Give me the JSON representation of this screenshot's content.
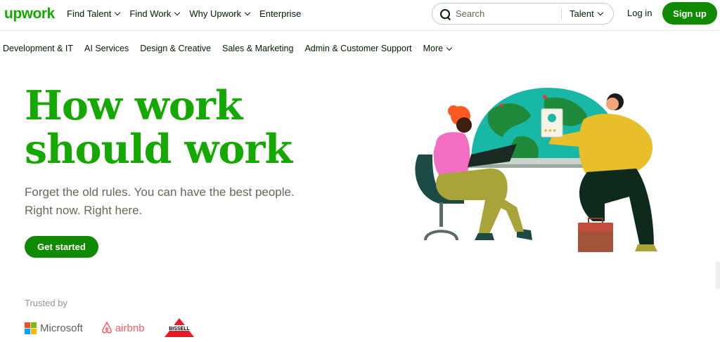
{
  "header": {
    "logo": "upwork",
    "nav": [
      {
        "label": "Find Talent",
        "has_dropdown": true
      },
      {
        "label": "Find Work",
        "has_dropdown": true
      },
      {
        "label": "Why Upwork",
        "has_dropdown": true
      },
      {
        "label": "Enterprise",
        "has_dropdown": false
      }
    ],
    "search": {
      "placeholder": "Search",
      "category": "Talent"
    },
    "login_label": "Log in",
    "signup_label": "Sign up"
  },
  "categories": [
    {
      "label": "Development & IT"
    },
    {
      "label": "AI Services"
    },
    {
      "label": "Design & Creative"
    },
    {
      "label": "Sales & Marketing"
    },
    {
      "label": "Admin & Customer Support"
    },
    {
      "label": "More",
      "has_dropdown": true
    }
  ],
  "hero": {
    "title_line1": "How work",
    "title_line2": "should work",
    "subtitle_line1": "Forget the old rules. You can have the best people.",
    "subtitle_line2": "Right now. Right here.",
    "cta_label": "Get started"
  },
  "trusted": {
    "label": "Trusted by",
    "brands": [
      "Microsoft",
      "airbnb",
      "BISSELL"
    ]
  },
  "colors": {
    "brand_green": "#14a800",
    "button_green": "#108a00",
    "text_dark": "#001e00",
    "text_muted": "#5e6d55"
  }
}
